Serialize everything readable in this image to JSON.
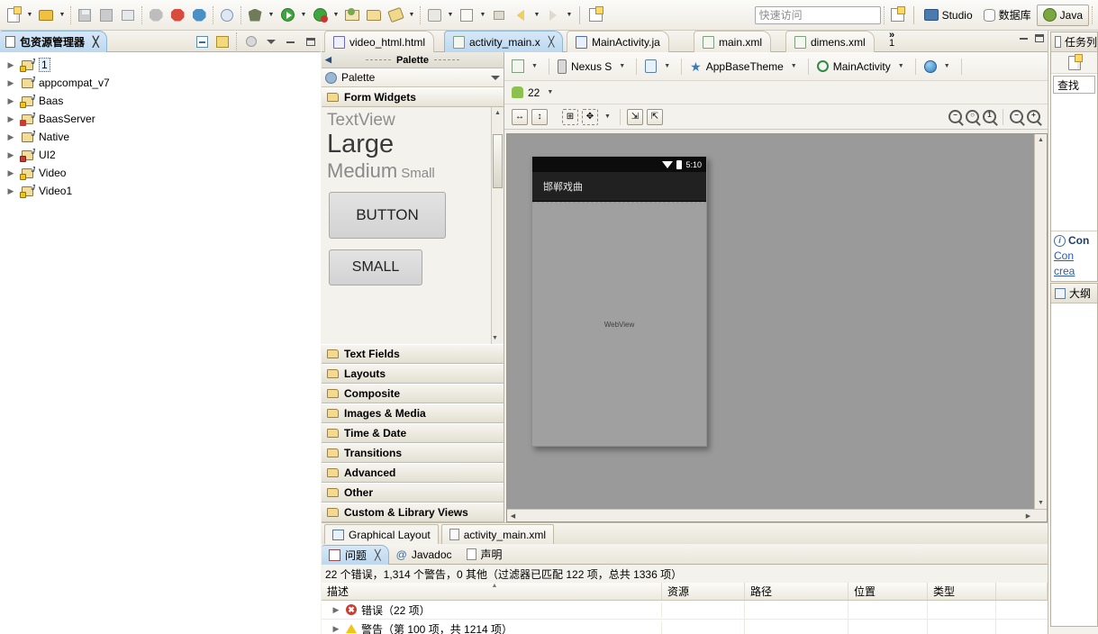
{
  "toolbar": {
    "quick_access_placeholder": "快速访问",
    "perspectives": [
      {
        "label": "Studio",
        "icon": "monitor-icon",
        "active": false
      },
      {
        "label": "数据库",
        "icon": "database-icon",
        "active": false
      },
      {
        "label": "Java",
        "icon": "java-icon",
        "active": true
      }
    ],
    "icons": [
      "new-icon",
      "open-resource-icon",
      "save-icon",
      "save-all-icon",
      "print-icon",
      "android-sdk-manager-icon",
      "android-avd-manager-icon",
      "android-lint-icon",
      "debug-step-icon",
      "debug-icon",
      "run-icon",
      "run-config-icon",
      "open-type-icon",
      "open-task-icon",
      "edit-icon",
      "undo-icon",
      "search-icon",
      "back-icon",
      "forward-icon",
      "new-window-icon"
    ]
  },
  "package_explorer": {
    "tab_label": "包资源管理器",
    "tools": [
      "collapse-all-icon",
      "link-with-editor-icon",
      "view-filters-icon",
      "view-menu-icon",
      "minimize-icon",
      "maximize-icon"
    ],
    "projects": [
      {
        "name": "1",
        "badge": "warning",
        "selected": true
      },
      {
        "name": "appcompat_v7",
        "badge": "none",
        "selected": false
      },
      {
        "name": "Baas",
        "badge": "warning",
        "selected": false
      },
      {
        "name": "BaasServer",
        "badge": "error",
        "selected": false
      },
      {
        "name": "Native",
        "badge": "none",
        "selected": false
      },
      {
        "name": "UI2",
        "badge": "error",
        "selected": false
      },
      {
        "name": "Video",
        "badge": "warning",
        "selected": false
      },
      {
        "name": "Video1",
        "badge": "warning",
        "selected": false
      }
    ]
  },
  "editor": {
    "tabs": [
      {
        "label": "video_html.html",
        "type": "html",
        "active": false,
        "closable": false
      },
      {
        "label": "activity_main.x",
        "type": "xml",
        "active": true,
        "closable": true
      },
      {
        "label": "MainActivity.ja",
        "type": "java",
        "active": false,
        "closable": false
      },
      {
        "label": "main.xml",
        "type": "xml",
        "active": false,
        "closable": false
      },
      {
        "label": "dimens.xml",
        "type": "xml",
        "active": false,
        "closable": false
      }
    ],
    "overflow_label": "»",
    "overflow_count": "1",
    "window_buttons": [
      "restore-icon",
      "maximize-icon"
    ],
    "bottom_tabs": [
      {
        "label": "Graphical Layout",
        "active": true,
        "icon": "graphical-layout-icon"
      },
      {
        "label": "activity_main.xml",
        "active": false,
        "icon": "xml-file-icon"
      }
    ]
  },
  "palette": {
    "header_title": "Palette",
    "bar_label": "Palette",
    "open_group": "Form Widgets",
    "widgets": {
      "textview": "TextView",
      "large": "Large",
      "medium": "Medium",
      "small": "Small",
      "button": "BUTTON",
      "small_button": "SMALL"
    },
    "groups": [
      "Text Fields",
      "Layouts",
      "Composite",
      "Images & Media",
      "Time & Date",
      "Transitions",
      "Advanced",
      "Other",
      "Custom & Library Views"
    ]
  },
  "config_bar": {
    "layout_variant": "",
    "device": "Nexus S",
    "orientation": "",
    "theme": "AppBaseTheme",
    "activity": "MainActivity",
    "locale": "",
    "api_level": "22"
  },
  "preview": {
    "status_time": "5:10",
    "app_title": "邯郸戏曲",
    "widget_label": "WebView"
  },
  "problems": {
    "tabs": [
      {
        "label": "问题",
        "active": true,
        "closable": true,
        "icon": "problems-icon"
      },
      {
        "label": "Javadoc",
        "active": false,
        "closable": false,
        "icon": "javadoc-icon"
      },
      {
        "label": "声明",
        "active": false,
        "closable": false,
        "icon": "declaration-icon"
      }
    ],
    "summary": "22 个错误，1,314 个警告，0 其他（过滤器已匹配 122 项，总共 1336 项）",
    "columns": [
      "描述",
      "资源",
      "路径",
      "位置",
      "类型"
    ],
    "rows": [
      {
        "description": "错误（22 项）",
        "severity": "error",
        "resource": "",
        "path": "",
        "location": "",
        "type": ""
      },
      {
        "description": "警告（第 100 项，共 1214 项）",
        "severity": "warning",
        "resource": "",
        "path": "",
        "location": "",
        "type": ""
      }
    ]
  },
  "right_sidebar": {
    "tasks": {
      "tab_label": "任务列",
      "new_task_icon": "new-task-icon",
      "filter_label": "查找"
    },
    "connect": {
      "title": "Con",
      "links": [
        "Con",
        "crea"
      ]
    },
    "outline": {
      "tab_label": "大纲"
    }
  }
}
